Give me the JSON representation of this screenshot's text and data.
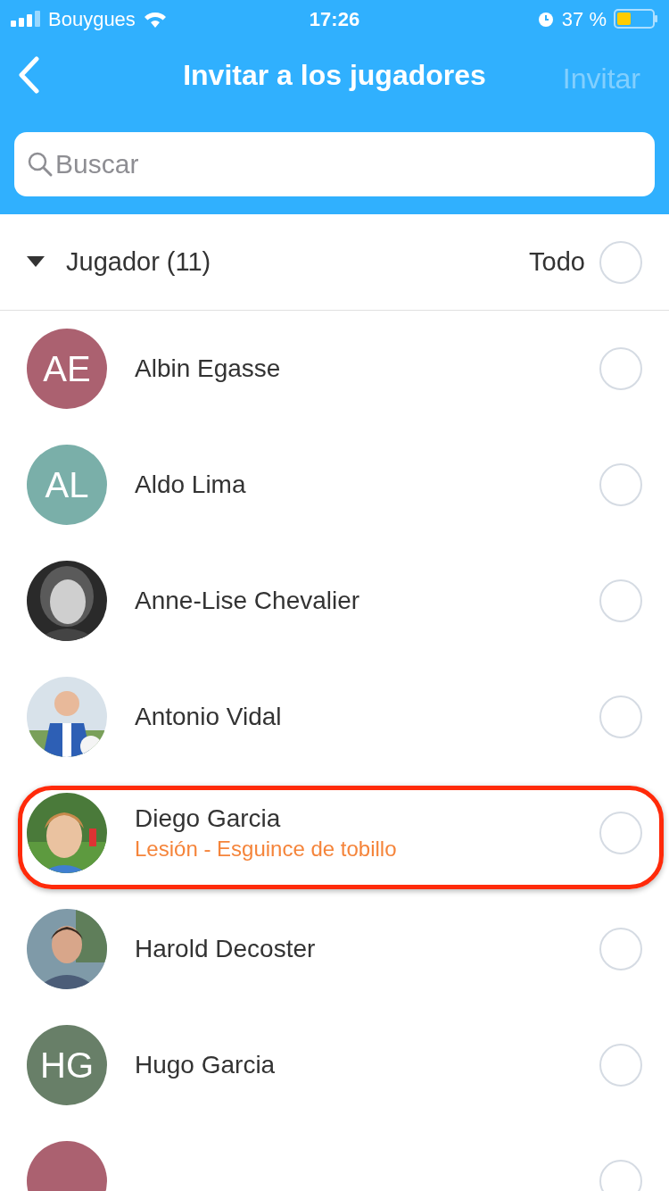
{
  "status_bar": {
    "carrier": "Bouygues",
    "time": "17:26",
    "battery": "37 %"
  },
  "nav": {
    "title": "Invitar a los jugadores",
    "action": "Invitar",
    "action_disabled": true
  },
  "search": {
    "placeholder": "Buscar"
  },
  "group": {
    "label": "Jugador (11)",
    "expanded": true,
    "all_label": "Todo",
    "all_checked": false
  },
  "players": [
    {
      "kind": "initials",
      "initials": "AE",
      "color": "#ab6170",
      "name": "Albin Egasse",
      "checked": false,
      "highlighted": false
    },
    {
      "kind": "initials",
      "initials": "AL",
      "color": "#7aafa9",
      "name": "Aldo Lima",
      "checked": false,
      "highlighted": false
    },
    {
      "kind": "picture",
      "name": "Anne-Lise Chevalier",
      "checked": false,
      "highlighted": false
    },
    {
      "kind": "picture",
      "name": "Antonio Vidal",
      "checked": false,
      "highlighted": false
    },
    {
      "kind": "picture",
      "name": "Diego Garcia",
      "note": "Lesión - Esguince de tobillo",
      "checked": false,
      "highlighted": true
    },
    {
      "kind": "picture",
      "name": "Harold Decoster",
      "checked": false,
      "highlighted": false
    },
    {
      "kind": "initials",
      "initials": "HG",
      "color": "#687f68",
      "name": "Hugo Garcia",
      "checked": false,
      "highlighted": false
    },
    {
      "kind": "partial",
      "color": "#ab6170",
      "checked": false,
      "highlighted": false
    }
  ]
}
